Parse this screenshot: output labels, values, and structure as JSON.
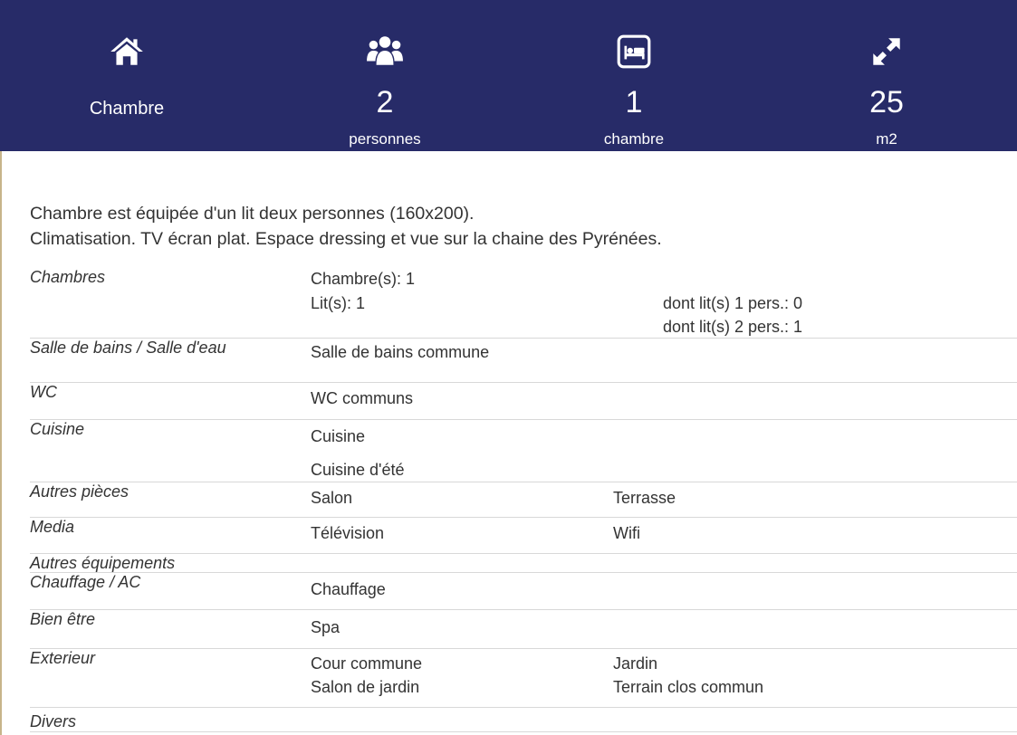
{
  "header": {
    "type_label": "Chambre",
    "persons": {
      "value": "2",
      "label": "personnes"
    },
    "bedrooms": {
      "value": "1",
      "label": "chambre"
    },
    "area": {
      "value": "25",
      "label": "m2"
    },
    "icons": [
      "home-icon",
      "users-icon",
      "bed-icon",
      "expand-icon"
    ],
    "background_color": "#272b68"
  },
  "description": {
    "line1": "Chambre est équipée d'un lit deux personnes (160x200).",
    "line2": "Climatisation. TV écran plat. Espace dressing et vue sur la chaine des Pyrénées."
  },
  "details": {
    "chambres": {
      "name": "Chambres",
      "count": "Chambre(s): 1",
      "beds": "Lit(s):  1",
      "single_beds": "dont lit(s) 1 pers.: 0",
      "double_beds": "dont lit(s) 2 pers.: 1"
    },
    "salle_de_bains": {
      "name": "Salle de bains / Salle d'eau",
      "value": "Salle de bains commune"
    },
    "wc": {
      "name": "WC",
      "value": "WC communs"
    },
    "cuisine": {
      "name": "Cuisine",
      "value1": "Cuisine",
      "value2": "Cuisine d'été"
    },
    "autres_pieces": {
      "name": "Autres pièces",
      "value1": "Salon",
      "value2": "Terrasse"
    },
    "media": {
      "name": "Media",
      "value1": "Télévision",
      "value2": "Wifi"
    },
    "autres_equipements": {
      "name": "Autres équipements"
    },
    "chauffage": {
      "name": "Chauffage / AC",
      "value": "Chauffage"
    },
    "bien_etre": {
      "name": "Bien être",
      "value": "Spa"
    },
    "exterieur": {
      "name": "Exterieur",
      "value1": "Cour commune",
      "value2": "Jardin",
      "value3": "Salon de jardin",
      "value4": "Terrain clos commun"
    },
    "divers": {
      "name": "Divers"
    }
  }
}
